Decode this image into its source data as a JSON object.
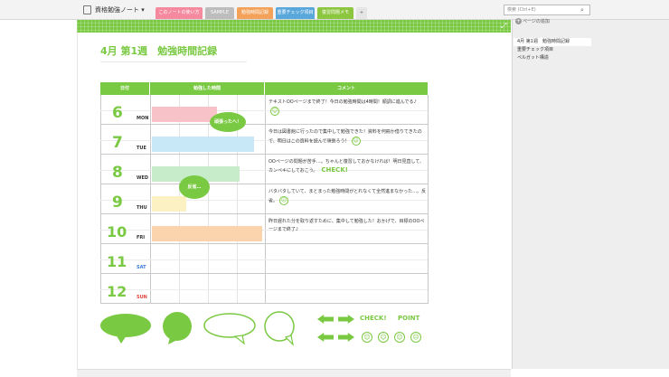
{
  "notebook": {
    "title": "資格勉強ノート ▾"
  },
  "tabs": [
    {
      "label": "このノートの使い方",
      "color": "#f58a9f"
    },
    {
      "label": "SAMPLE",
      "color": "#bdbdbd"
    },
    {
      "label": "勉強時間記録",
      "color": "#f4a259"
    },
    {
      "label": "重要チェック項目",
      "color": "#5aa7dc"
    },
    {
      "label": "復習問題メモ",
      "color": "#8cc63f"
    },
    {
      "label": "+",
      "color": "#e5e5e5"
    }
  ],
  "search": {
    "placeholder": "検索 (Ctrl+E)"
  },
  "sidebar": {
    "add_page": "ページの追加",
    "pages": [
      {
        "label": "4月 第1週　勉強時間記録"
      },
      {
        "label": "重要チェック項目"
      },
      {
        "label": "ペルガット構造"
      }
    ]
  },
  "page": {
    "title": "4月 第1週　勉強時間記録",
    "table": {
      "headers": [
        "日付",
        "勉強した時間",
        "コメント"
      ],
      "rows": [
        {
          "day": "6",
          "dow": "MON",
          "dow_color": "#333333",
          "study": 0.6,
          "bar_color": "#f8c3c8",
          "comment": "テキストOOページまで終了！今日の勉強時間は4時間！順調に進んでる♪",
          "mark": "☺"
        },
        {
          "day": "7",
          "dow": "TUE",
          "dow_color": "#333333",
          "study": 0.93,
          "bar_color": "#c9e8f7",
          "comment": "今日は図書館に行ったので集中して勉強できた！資料を何冊か借りてきたので、明日はこの資料を読んで頑張ろう！",
          "mark": "☺"
        },
        {
          "day": "8",
          "dow": "WED",
          "dow_color": "#333333",
          "study": 0.8,
          "bar_color": "#c7ecc9",
          "comment": "OOページの問題が苦手…。ちゃんと復習しておかなければ！明日見直して、カンペキにしておこう。",
          "mark": "CHECK!"
        },
        {
          "day": "9",
          "dow": "THU",
          "dow_color": "#333333",
          "study": 0.33,
          "bar_color": "#fbf1c2",
          "comment": "バタバタしていて、まとまった勉強時間がとれなくて全然進まなかった…。反省。",
          "mark": "☹"
        },
        {
          "day": "10",
          "dow": "FRI",
          "dow_color": "#333333",
          "study": 1.0,
          "bar_color": "#fbd3ad",
          "comment": "昨日遅れた分を取り返すために、集中して勉強した！おかげで、目標のOOページまで終了♪",
          "mark": ""
        },
        {
          "day": "11",
          "dow": "SAT",
          "dow_color": "#3a7cd8",
          "study": 0,
          "bar_color": "",
          "comment": "",
          "mark": ""
        },
        {
          "day": "12",
          "dow": "SUN",
          "dow_color": "#e0443c",
          "study": 0,
          "bar_color": "",
          "comment": "",
          "mark": ""
        }
      ],
      "bubbles": [
        "頑張ったへ！",
        "反省…"
      ]
    },
    "decorations": {
      "check_label": "CHECK!",
      "point_label": "POINT"
    }
  }
}
